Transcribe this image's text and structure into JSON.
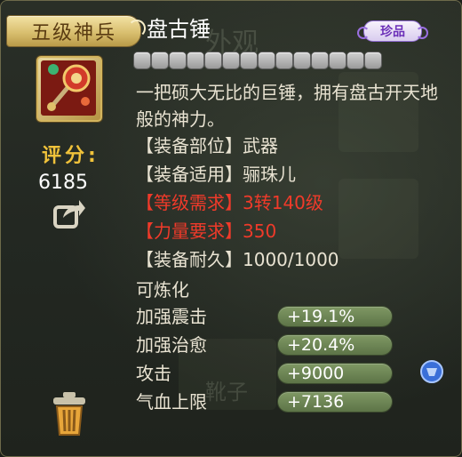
{
  "tooltip": {
    "tier_badge": "五级神兵",
    "item_name": "盘古锤",
    "rarity": "珍品",
    "stars_count": 14,
    "description": "一把硕大无比的巨锤，拥有盘古开天地般的神力。",
    "score_label": "评分:",
    "score_value": "6185",
    "attributes": [
      {
        "text": "【装备部位】武器",
        "color": "normal"
      },
      {
        "text": "【装备适用】骊珠儿",
        "color": "normal"
      },
      {
        "text": "【等级需求】3转140级",
        "color": "red"
      },
      {
        "text": "【力量要求】350",
        "color": "red"
      },
      {
        "text": "【装备耐久】1000/1000",
        "color": "normal"
      }
    ],
    "refinable": "可炼化",
    "stats": [
      {
        "label": "加强震击",
        "value": "+19.1%"
      },
      {
        "label": "加强治愈",
        "value": "+20.4%"
      },
      {
        "label": "攻击",
        "value": "+9000"
      },
      {
        "label": "气血上限",
        "value": "+7136"
      }
    ],
    "background_text": {
      "a": "外观",
      "b": "靴子"
    }
  },
  "icons": {
    "item": "hammer-icon",
    "share": "share-icon",
    "trash": "trash-icon",
    "gem": "gem-icon"
  },
  "colors": {
    "gold_label": "#f0c23a",
    "red_requirement": "#f03a2a",
    "stat_bar": "#6e8757",
    "rarity_purple": "#6b2fb8"
  }
}
